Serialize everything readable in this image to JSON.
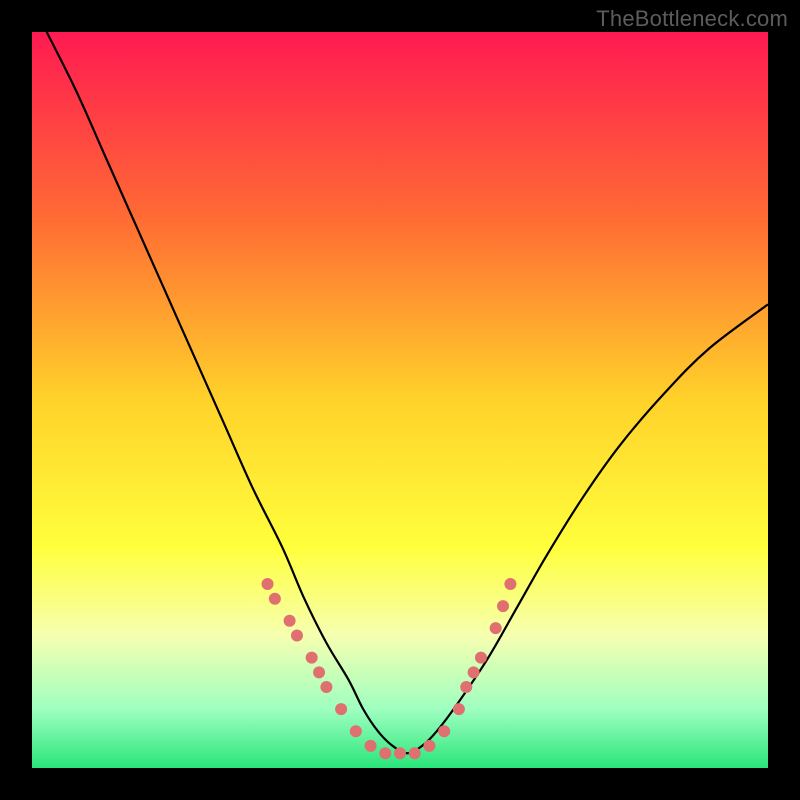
{
  "watermark": "TheBottleneck.com",
  "chart_data": {
    "type": "line",
    "title": "",
    "xlabel": "",
    "ylabel": "",
    "xlim": [
      0,
      100
    ],
    "ylim": [
      0,
      100
    ],
    "gradient_stops": [
      {
        "offset": 0,
        "color": "#ff1a52"
      },
      {
        "offset": 25,
        "color": "#ff6a34"
      },
      {
        "offset": 50,
        "color": "#ffd22a"
      },
      {
        "offset": 70,
        "color": "#ffff3c"
      },
      {
        "offset": 82,
        "color": "#f6ffb0"
      },
      {
        "offset": 92,
        "color": "#9fffc0"
      },
      {
        "offset": 100,
        "color": "#28e57a"
      }
    ],
    "series": [
      {
        "name": "curve",
        "x": [
          2,
          6,
          10,
          14,
          18,
          22,
          26,
          30,
          34,
          37,
          40,
          43,
          45,
          47,
          49,
          51,
          53,
          55,
          58,
          62,
          66,
          70,
          75,
          80,
          86,
          92,
          100
        ],
        "y": [
          100,
          92,
          83,
          74,
          65,
          56,
          47,
          38,
          30,
          23,
          17,
          12,
          8,
          5,
          3,
          2,
          3,
          5,
          9,
          15,
          22,
          29,
          37,
          44,
          51,
          57,
          63
        ]
      }
    ],
    "markers": {
      "color": "#e07070",
      "radius": 6,
      "points": [
        {
          "x": 32,
          "y": 25
        },
        {
          "x": 33,
          "y": 23
        },
        {
          "x": 35,
          "y": 20
        },
        {
          "x": 36,
          "y": 18
        },
        {
          "x": 38,
          "y": 15
        },
        {
          "x": 39,
          "y": 13
        },
        {
          "x": 40,
          "y": 11
        },
        {
          "x": 42,
          "y": 8
        },
        {
          "x": 44,
          "y": 5
        },
        {
          "x": 46,
          "y": 3
        },
        {
          "x": 48,
          "y": 2
        },
        {
          "x": 50,
          "y": 2
        },
        {
          "x": 52,
          "y": 2
        },
        {
          "x": 54,
          "y": 3
        },
        {
          "x": 56,
          "y": 5
        },
        {
          "x": 58,
          "y": 8
        },
        {
          "x": 59,
          "y": 11
        },
        {
          "x": 60,
          "y": 13
        },
        {
          "x": 61,
          "y": 15
        },
        {
          "x": 63,
          "y": 19
        },
        {
          "x": 64,
          "y": 22
        },
        {
          "x": 65,
          "y": 25
        }
      ]
    }
  }
}
